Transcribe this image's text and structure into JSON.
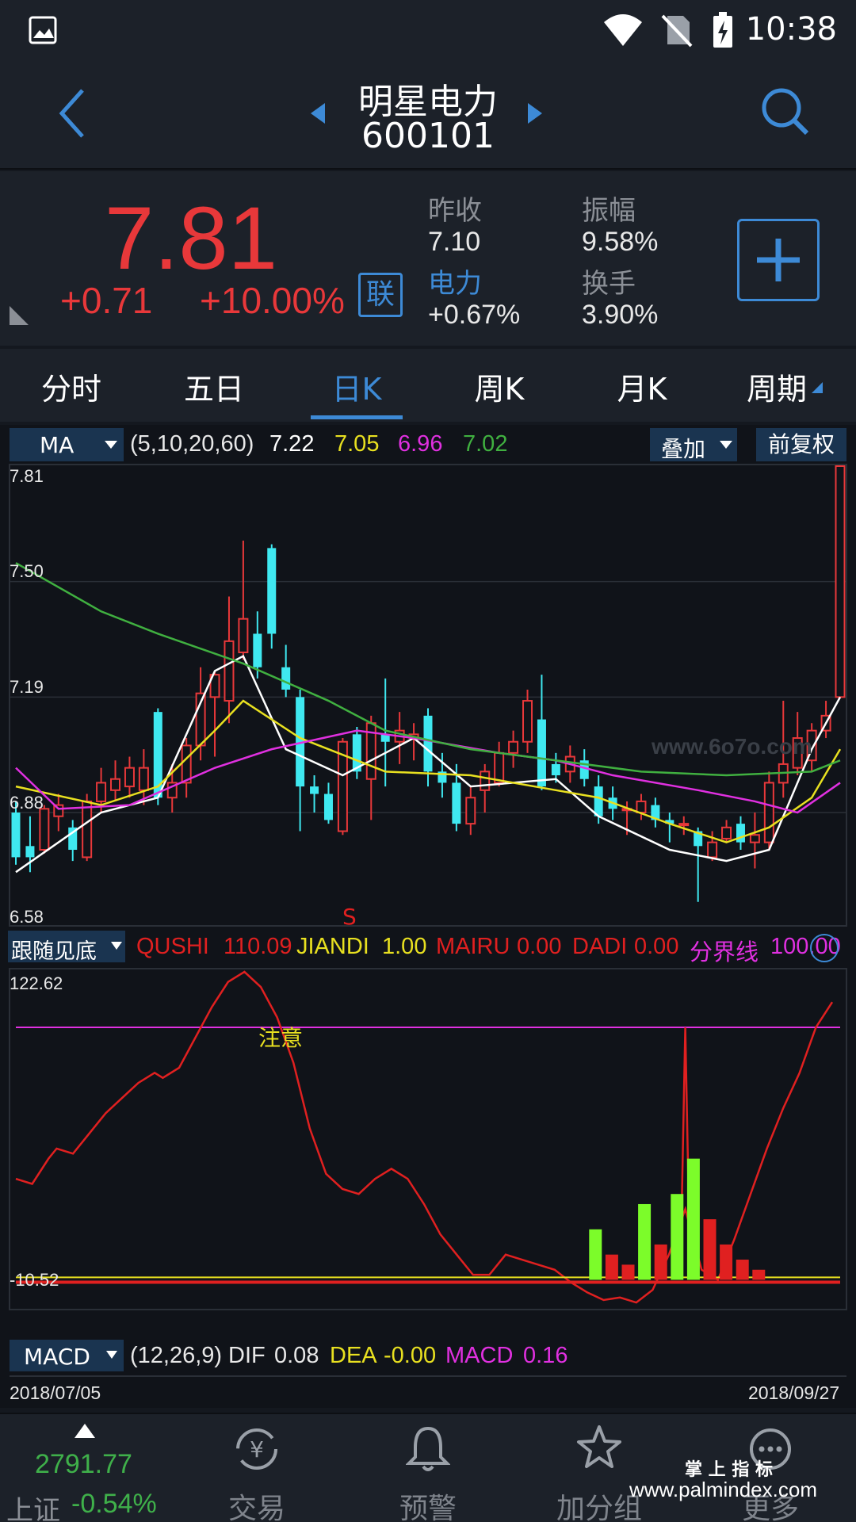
{
  "status_bar": {
    "time": "10:38"
  },
  "header": {
    "stock_name": "明星电力",
    "stock_code": "600101"
  },
  "quote": {
    "price": "7.81",
    "change": "+0.71",
    "change_pct": "+10.00%",
    "lian_label": "联",
    "prev_close_label": "昨收",
    "prev_close": "7.10",
    "sector_label": "电力",
    "sector_change": "+0.67%",
    "amplitude_label": "振幅",
    "amplitude": "9.58%",
    "turnover_label": "换手",
    "turnover": "3.90%"
  },
  "tabs": [
    "分时",
    "五日",
    "日K",
    "周K",
    "月K",
    "周期"
  ],
  "active_tab": "日K",
  "main_chart": {
    "indicator": "MA",
    "params": "(5,10,20,60)",
    "ma_values": [
      "7.22",
      "7.05",
      "6.96",
      "7.02"
    ],
    "ma_colors": [
      "#ffffff",
      "#e8e020",
      "#e030e0",
      "#40b040"
    ],
    "overlay_label": "叠加",
    "adjust_label": "前复权",
    "price_ticks": [
      "7.81",
      "7.50",
      "7.19",
      "6.88",
      "6.58"
    ],
    "signal_marker": "S",
    "watermark": "www.6o7o.com"
  },
  "sub_chart": {
    "indicator": "跟随见底",
    "items": [
      {
        "label": "QUSHI",
        "value": "110.09",
        "color": "#e02020"
      },
      {
        "label": "JIANDI",
        "value": "1.00",
        "color": "#e8e020"
      },
      {
        "label": "MAIRU",
        "value": "0.00",
        "color": "#e02020"
      },
      {
        "label": "DADI",
        "value": "0.00",
        "color": "#e02020"
      },
      {
        "label": "分界线",
        "value": "100.00",
        "color": "#e030e0"
      }
    ],
    "top_tick": "122.62",
    "bottom_tick": "-10.52",
    "annotation": "注意"
  },
  "macd_bar": {
    "indicator": "MACD",
    "params": "(12,26,9)",
    "dif_label": "DIF",
    "dif": "0.08",
    "dea_label": "DEA",
    "dea": "-0.00",
    "macd_label": "MACD",
    "macd": "0.16"
  },
  "date_range": {
    "start": "2018/07/05",
    "end": "2018/09/27"
  },
  "bottom_nav": {
    "index_value": "2791.77",
    "index_name": "上证",
    "index_change": "-0.54%",
    "items": [
      "交易",
      "预警",
      "加分组",
      "更多"
    ]
  },
  "corner_watermark": {
    "line1": "掌 上 指 标",
    "line2": "www.palmindex.com"
  },
  "chart_data": {
    "type": "candlestick",
    "price_axis": [
      6.58,
      7.81
    ],
    "ma_lines": [
      {
        "name": "MA5",
        "color": "#ffffff",
        "points": [
          [
            0,
            6.72
          ],
          [
            6,
            6.88
          ],
          [
            10,
            6.92
          ],
          [
            14,
            7.26
          ],
          [
            16,
            7.3
          ],
          [
            19,
            7.05
          ],
          [
            23,
            6.98
          ],
          [
            28,
            7.08
          ],
          [
            32,
            6.95
          ],
          [
            38,
            6.97
          ],
          [
            41,
            6.87
          ],
          [
            46,
            6.78
          ],
          [
            50,
            6.75
          ],
          [
            53,
            6.78
          ],
          [
            56,
            7.05
          ],
          [
            58,
            7.19
          ]
        ]
      },
      {
        "name": "MA10",
        "color": "#e8e020",
        "points": [
          [
            0,
            6.95
          ],
          [
            6,
            6.9
          ],
          [
            10,
            6.95
          ],
          [
            14,
            7.1
          ],
          [
            16,
            7.18
          ],
          [
            20,
            7.08
          ],
          [
            26,
            6.99
          ],
          [
            32,
            6.98
          ],
          [
            38,
            6.94
          ],
          [
            41,
            6.92
          ],
          [
            46,
            6.85
          ],
          [
            50,
            6.8
          ],
          [
            53,
            6.84
          ],
          [
            56,
            6.92
          ],
          [
            58,
            7.05
          ]
        ]
      },
      {
        "name": "MA20",
        "color": "#e030e0",
        "points": [
          [
            0,
            7.0
          ],
          [
            3,
            6.89
          ],
          [
            8,
            6.9
          ],
          [
            14,
            7.0
          ],
          [
            18,
            7.05
          ],
          [
            24,
            7.1
          ],
          [
            28,
            7.08
          ],
          [
            34,
            7.04
          ],
          [
            38,
            7.02
          ],
          [
            42,
            6.98
          ],
          [
            48,
            6.94
          ],
          [
            52,
            6.91
          ],
          [
            55,
            6.88
          ],
          [
            58,
            6.96
          ]
        ]
      },
      {
        "name": "MA60",
        "color": "#40b040",
        "points": [
          [
            0,
            7.55
          ],
          [
            6,
            7.42
          ],
          [
            10,
            7.36
          ],
          [
            16,
            7.28
          ],
          [
            22,
            7.18
          ],
          [
            26,
            7.1
          ],
          [
            32,
            7.05
          ],
          [
            38,
            7.02
          ],
          [
            44,
            6.99
          ],
          [
            50,
            6.98
          ],
          [
            56,
            6.99
          ],
          [
            58,
            7.02
          ]
        ]
      }
    ],
    "candles": [
      [
        0,
        6.88,
        6.76,
        6.91,
        6.74
      ],
      [
        1,
        6.79,
        6.76,
        6.87,
        6.72
      ],
      [
        2,
        6.78,
        6.89,
        6.9,
        6.77
      ],
      [
        3,
        6.87,
        6.9,
        6.93,
        6.83
      ],
      [
        4,
        6.84,
        6.78,
        6.86,
        6.75
      ],
      [
        5,
        6.76,
        6.91,
        6.93,
        6.75
      ],
      [
        6,
        6.91,
        6.96,
        7.0,
        6.88
      ],
      [
        7,
        6.94,
        6.97,
        7.02,
        6.91
      ],
      [
        8,
        6.95,
        7.0,
        7.03,
        6.92
      ],
      [
        9,
        6.94,
        7.0,
        7.05,
        6.9
      ],
      [
        10,
        7.15,
        6.92,
        7.16,
        6.9
      ],
      [
        11,
        6.92,
        6.96,
        7.01,
        6.88
      ],
      [
        12,
        6.96,
        7.06,
        7.08,
        6.92
      ],
      [
        13,
        7.06,
        7.2,
        7.27,
        7.02
      ],
      [
        14,
        7.19,
        7.25,
        7.26,
        7.03
      ],
      [
        15,
        7.18,
        7.34,
        7.46,
        7.12
      ],
      [
        16,
        7.31,
        7.4,
        7.61,
        7.29
      ],
      [
        17,
        7.36,
        7.27,
        7.42,
        7.24
      ],
      [
        18,
        7.59,
        7.36,
        7.6,
        7.32
      ],
      [
        19,
        7.27,
        7.21,
        7.33,
        7.19
      ],
      [
        20,
        7.19,
        6.95,
        7.21,
        6.83
      ],
      [
        21,
        6.95,
        6.93,
        6.98,
        6.88
      ],
      [
        22,
        6.93,
        6.86,
        6.96,
        6.85
      ],
      [
        23,
        6.83,
        7.07,
        7.08,
        6.82
      ],
      [
        24,
        7.09,
        6.99,
        7.11,
        6.97
      ],
      [
        25,
        6.97,
        7.12,
        7.14,
        6.86
      ],
      [
        26,
        7.09,
        7.07,
        7.24,
        6.95
      ],
      [
        27,
        7.07,
        7.1,
        7.15,
        7.01
      ],
      [
        28,
        7.08,
        7.09,
        7.12,
        7.02
      ],
      [
        29,
        7.14,
        6.99,
        7.16,
        6.95
      ],
      [
        30,
        6.99,
        6.96,
        7.04,
        6.92
      ],
      [
        31,
        6.96,
        6.85,
        7.01,
        6.83
      ],
      [
        32,
        6.85,
        6.92,
        6.95,
        6.82
      ],
      [
        33,
        6.94,
        6.99,
        7.01,
        6.88
      ],
      [
        34,
        6.96,
        7.04,
        7.07,
        6.95
      ],
      [
        35,
        7.04,
        7.07,
        7.1,
        7.0
      ],
      [
        36,
        7.07,
        7.18,
        7.21,
        7.04
      ],
      [
        37,
        7.13,
        6.95,
        7.25,
        6.94
      ],
      [
        38,
        7.01,
        6.98,
        7.04,
        6.96
      ],
      [
        39,
        6.99,
        7.03,
        7.06,
        6.96
      ],
      [
        40,
        7.02,
        6.97,
        7.05,
        6.95
      ],
      [
        41,
        6.95,
        6.87,
        6.98,
        6.85
      ],
      [
        42,
        6.92,
        6.89,
        6.95,
        6.86
      ],
      [
        43,
        6.89,
        6.89,
        6.91,
        6.82
      ],
      [
        44,
        6.88,
        6.91,
        6.93,
        6.86
      ],
      [
        45,
        6.9,
        6.86,
        6.92,
        6.84
      ],
      [
        46,
        6.86,
        6.85,
        6.88,
        6.8
      ],
      [
        47,
        6.85,
        6.85,
        6.87,
        6.82
      ],
      [
        48,
        6.83,
        6.79,
        6.84,
        6.64
      ],
      [
        49,
        6.76,
        6.8,
        6.83,
        6.75
      ],
      [
        50,
        6.81,
        6.84,
        6.86,
        6.8
      ],
      [
        51,
        6.85,
        6.8,
        6.87,
        6.78
      ],
      [
        52,
        6.8,
        6.82,
        6.88,
        6.73
      ],
      [
        53,
        6.8,
        6.96,
        6.99,
        6.78
      ],
      [
        54,
        6.96,
        7.01,
        7.18,
        6.92
      ],
      [
        55,
        7.0,
        7.08,
        7.15,
        6.98
      ],
      [
        56,
        7.02,
        7.1,
        7.12,
        6.99
      ],
      [
        57,
        7.1,
        7.14,
        7.18,
        7.08
      ],
      [
        58,
        7.19,
        7.81,
        7.81,
        7.19
      ]
    ],
    "candle_columns": [
      "index",
      "open",
      "close",
      "high",
      "low"
    ]
  }
}
